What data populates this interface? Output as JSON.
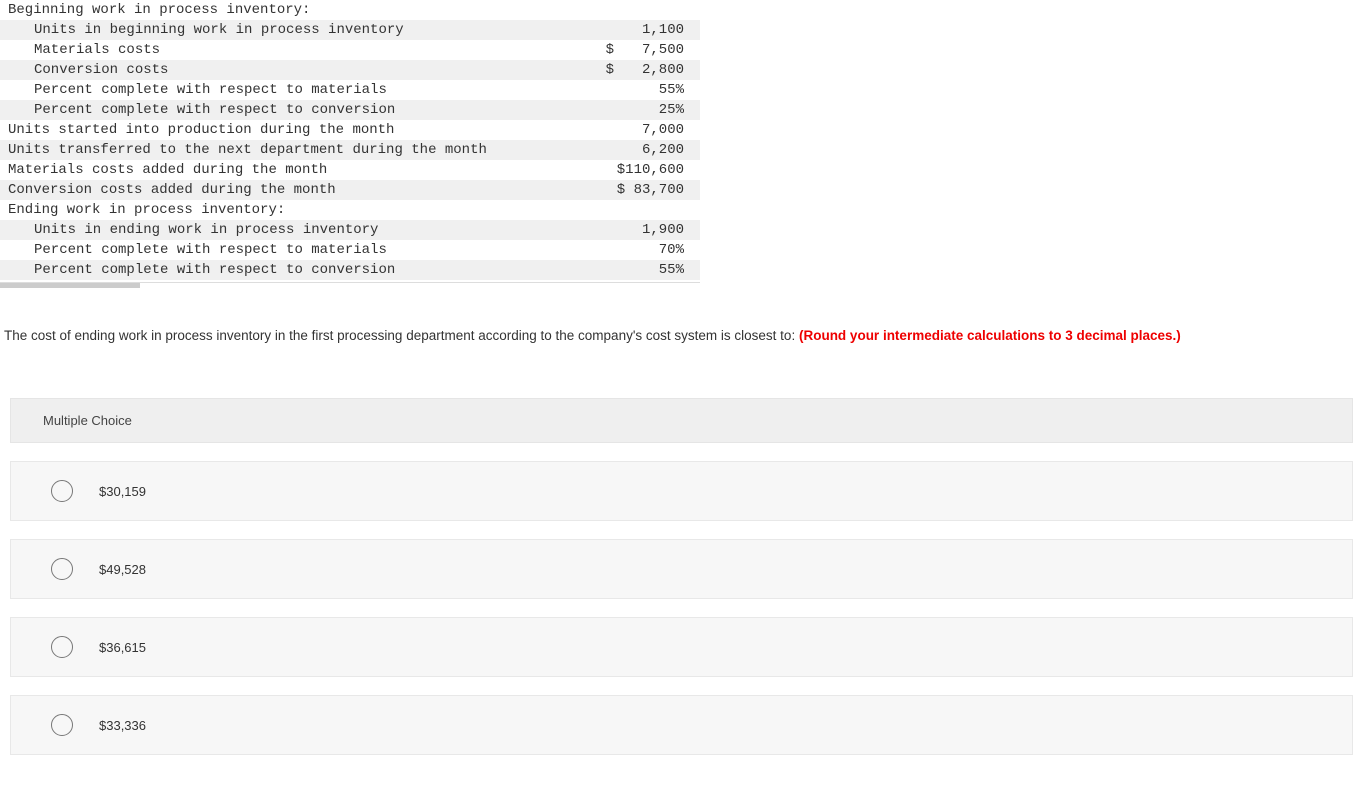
{
  "dataTable": {
    "rows": [
      {
        "label": "Beginning work in process inventory:",
        "indent": false,
        "shaded": false,
        "currency": "",
        "amount": ""
      },
      {
        "label": "Units in beginning work in process inventory",
        "indent": true,
        "shaded": true,
        "currency": "",
        "amount": "1,100"
      },
      {
        "label": "Materials costs",
        "indent": true,
        "shaded": false,
        "currency": "$",
        "amount": "7,500"
      },
      {
        "label": "Conversion costs",
        "indent": true,
        "shaded": true,
        "currency": "$",
        "amount": "2,800"
      },
      {
        "label": "Percent complete with respect to materials",
        "indent": true,
        "shaded": false,
        "currency": "",
        "amount": "55%"
      },
      {
        "label": "Percent complete with respect to conversion",
        "indent": true,
        "shaded": true,
        "currency": "",
        "amount": "25%"
      },
      {
        "label": "Units started into production during the month",
        "indent": false,
        "shaded": false,
        "currency": "",
        "amount": "7,000"
      },
      {
        "label": "Units transferred to the next department during the month",
        "indent": false,
        "shaded": true,
        "currency": "",
        "amount": "6,200"
      },
      {
        "label": "Materials costs added during the month",
        "indent": false,
        "shaded": false,
        "currency": "",
        "amount": "$110,600"
      },
      {
        "label": "Conversion costs added during the month",
        "indent": false,
        "shaded": true,
        "currency": "",
        "amount": "$ 83,700"
      },
      {
        "label": "Ending work in process inventory:",
        "indent": false,
        "shaded": false,
        "currency": "",
        "amount": ""
      },
      {
        "label": "Units in ending work in process inventory",
        "indent": true,
        "shaded": true,
        "currency": "",
        "amount": "1,900"
      },
      {
        "label": "Percent complete with respect to materials",
        "indent": true,
        "shaded": false,
        "currency": "",
        "amount": "70%"
      },
      {
        "label": "Percent complete with respect to conversion",
        "indent": true,
        "shaded": true,
        "currency": "",
        "amount": "55%"
      }
    ]
  },
  "question": {
    "text": "The cost of ending work in process inventory in the first processing department according to the company's cost system is closest to: ",
    "note": "(Round your intermediate calculations to 3 decimal places.)"
  },
  "mc": {
    "header": "Multiple Choice",
    "options": [
      "$30,159",
      "$49,528",
      "$36,615",
      "$33,336"
    ]
  }
}
